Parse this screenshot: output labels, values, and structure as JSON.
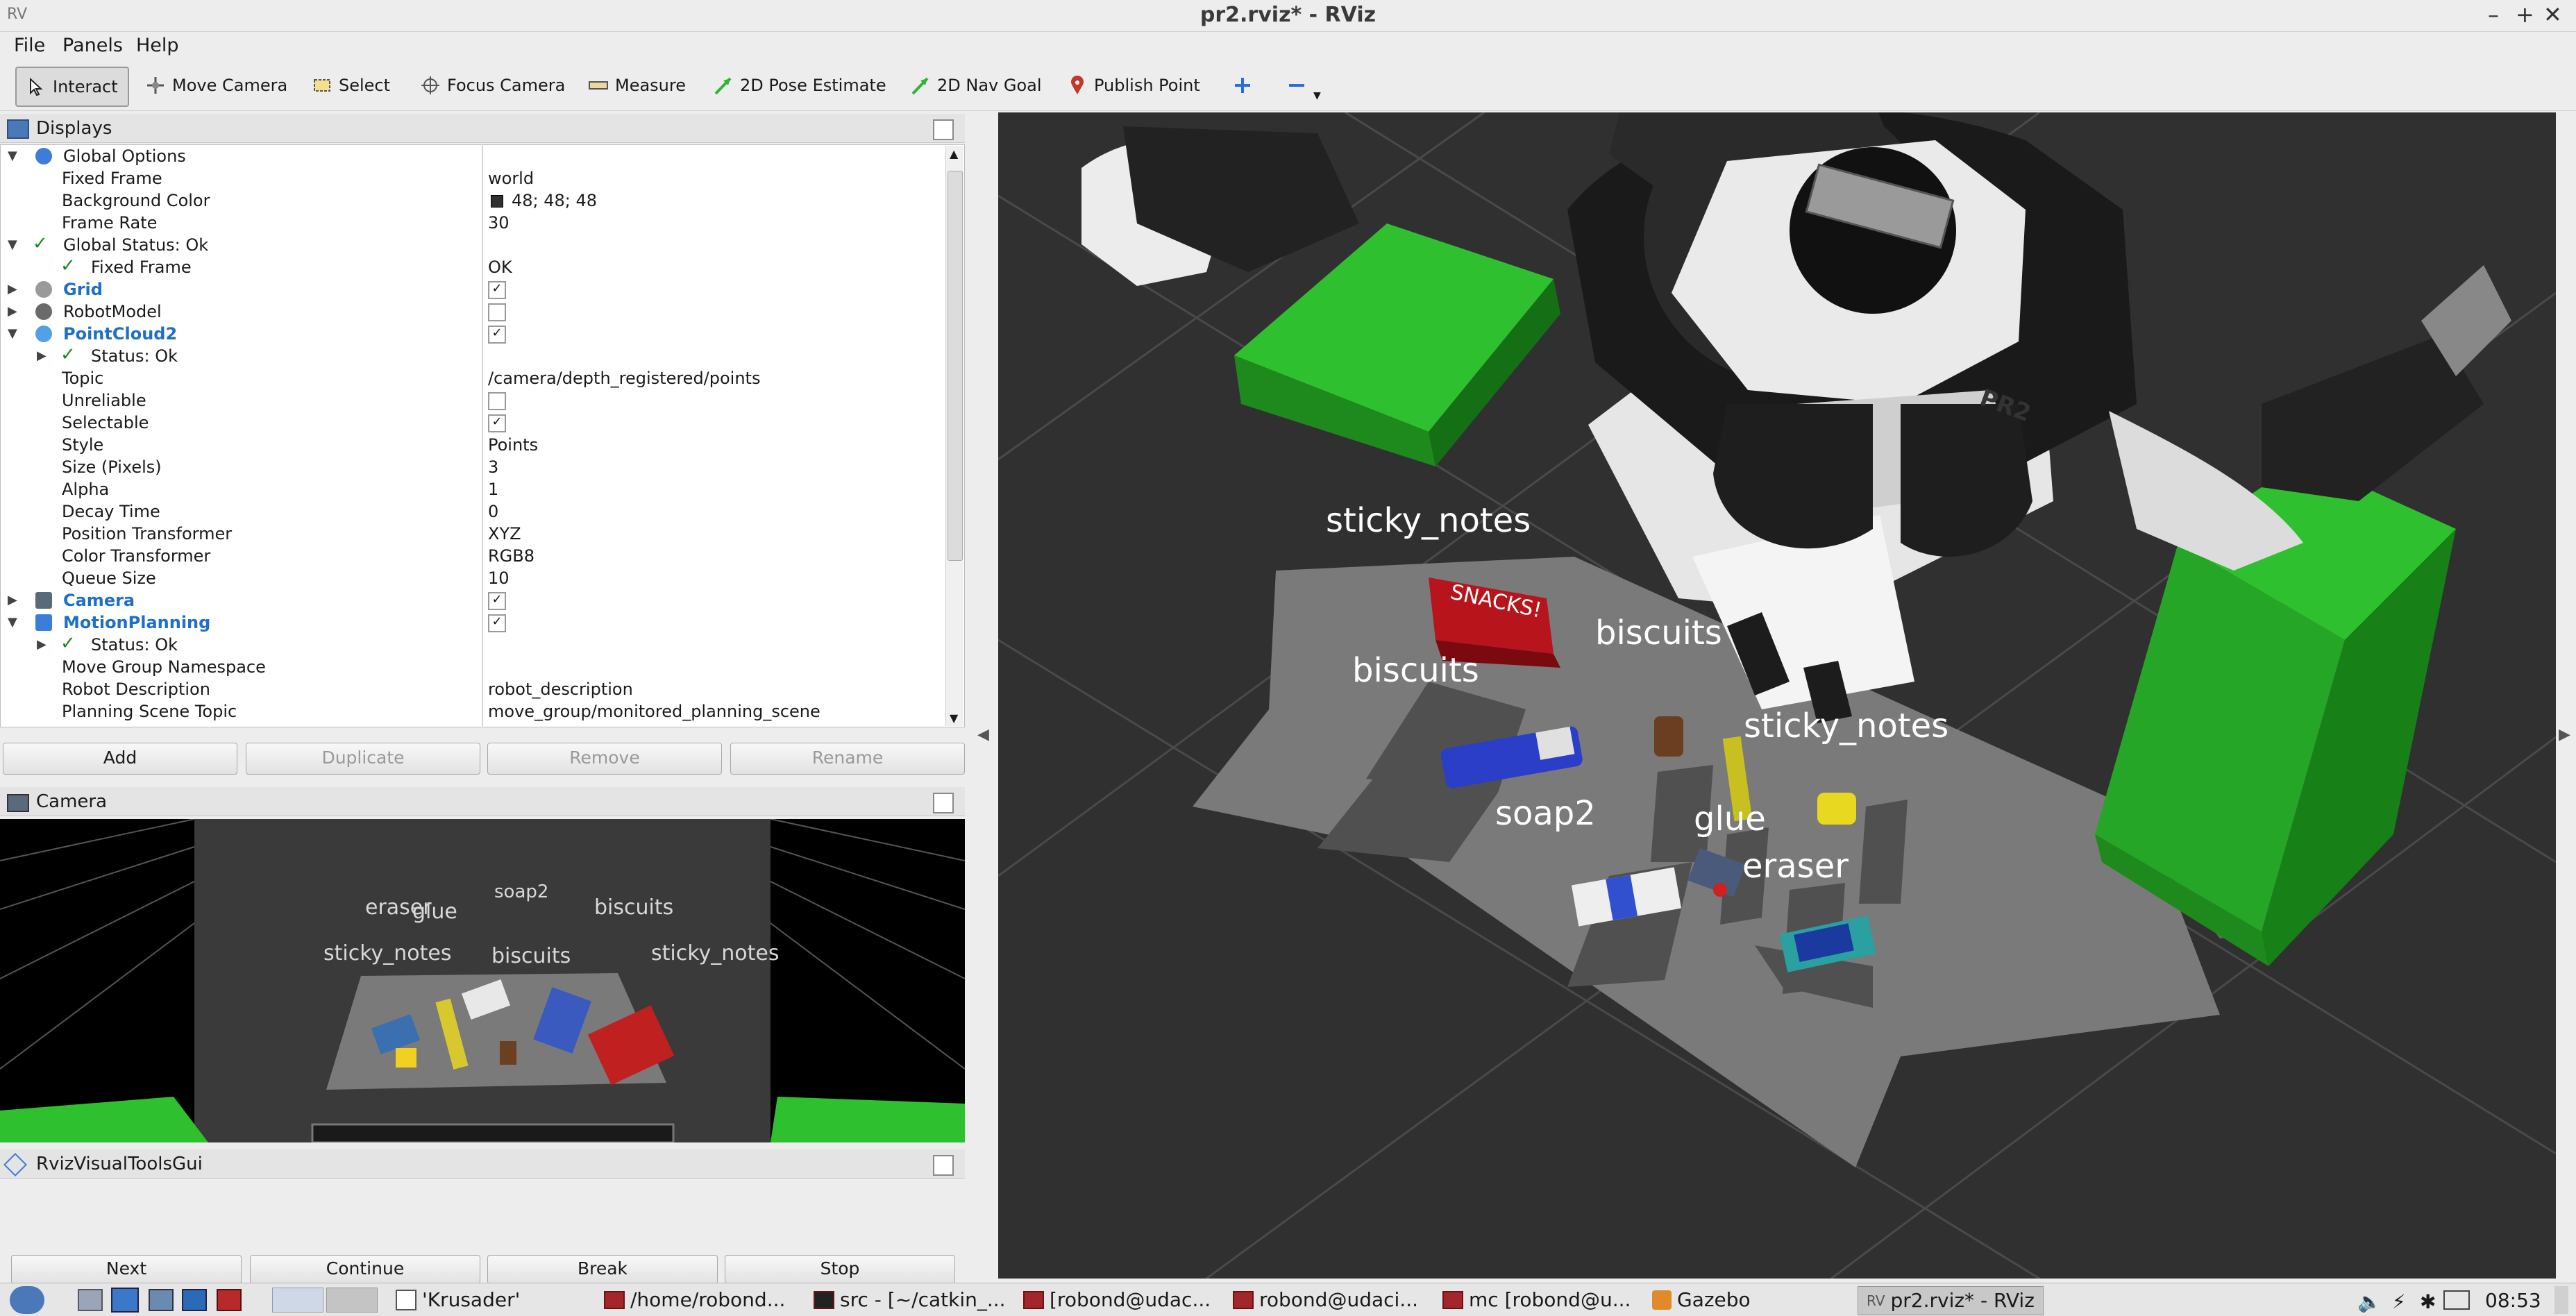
{
  "window": {
    "title": "pr2.rviz* - RViz",
    "min": "–",
    "max": "+",
    "close": "✕"
  },
  "menu": [
    "File",
    "Panels",
    "Help"
  ],
  "toolbar": [
    {
      "label": "Interact"
    },
    {
      "label": "Move Camera"
    },
    {
      "label": "Select"
    },
    {
      "label": "Focus Camera"
    },
    {
      "label": "Measure"
    },
    {
      "label": "2D Pose Estimate"
    },
    {
      "label": "2D Nav Goal"
    },
    {
      "label": "Publish Point"
    }
  ],
  "displays": {
    "title": "Displays",
    "rows": [
      {
        "label": "Global Options",
        "value": ""
      },
      {
        "label": "Fixed Frame",
        "value": "world"
      },
      {
        "label": "Background Color",
        "value": "48; 48; 48"
      },
      {
        "label": "Frame Rate",
        "value": "30"
      },
      {
        "label": "Global Status: Ok",
        "value": ""
      },
      {
        "label": "Fixed Frame",
        "value": "OK"
      },
      {
        "label": "Grid",
        "value": ""
      },
      {
        "label": "RobotModel",
        "value": ""
      },
      {
        "label": "PointCloud2",
        "value": ""
      },
      {
        "label": "Status: Ok",
        "value": ""
      },
      {
        "label": "Topic",
        "value": "/camera/depth_registered/points"
      },
      {
        "label": "Unreliable",
        "value": ""
      },
      {
        "label": "Selectable",
        "value": ""
      },
      {
        "label": "Style",
        "value": "Points"
      },
      {
        "label": "Size (Pixels)",
        "value": "3"
      },
      {
        "label": "Alpha",
        "value": "1"
      },
      {
        "label": "Decay Time",
        "value": "0"
      },
      {
        "label": "Position Transformer",
        "value": "XYZ"
      },
      {
        "label": "Color Transformer",
        "value": "RGB8"
      },
      {
        "label": "Queue Size",
        "value": "10"
      },
      {
        "label": "Camera",
        "value": ""
      },
      {
        "label": "MotionPlanning",
        "value": ""
      },
      {
        "label": "Status: Ok",
        "value": ""
      },
      {
        "label": "Move Group Namespace",
        "value": ""
      },
      {
        "label": "Robot Description",
        "value": "robot_description"
      },
      {
        "label": "Planning Scene Topic",
        "value": "move_group/monitored_planning_scene"
      }
    ],
    "buttons": [
      "Add",
      "Duplicate",
      "Remove",
      "Rename"
    ]
  },
  "camera_panel": {
    "title": "Camera",
    "labels": [
      "eraser",
      "glue",
      "soap2",
      "biscuits",
      "sticky_notes",
      "biscuits",
      "sticky_notes"
    ]
  },
  "rviz_gui": {
    "title": "RvizVisualToolsGui",
    "buttons": [
      "Next",
      "Continue",
      "Break",
      "Stop"
    ]
  },
  "scene_labels": [
    "sticky_notes",
    "biscuits",
    "biscuits",
    "sticky_notes",
    "soap2",
    "glue",
    "eraser"
  ],
  "box_text": "SNACKS!",
  "robot_text": "PR2",
  "taskbar": {
    "items": [
      "'Krusader'",
      "/home/robond...",
      "src - [~/catkin_...",
      "[robond@udac...",
      "robond@udaci...",
      "mc [robond@u...",
      "Gazebo",
      "pr2.rviz* - RViz"
    ],
    "clock": "08:53"
  },
  "colors": {
    "background": "#303030",
    "tray": "#2fc02f",
    "accent": "#1f6fc8"
  }
}
